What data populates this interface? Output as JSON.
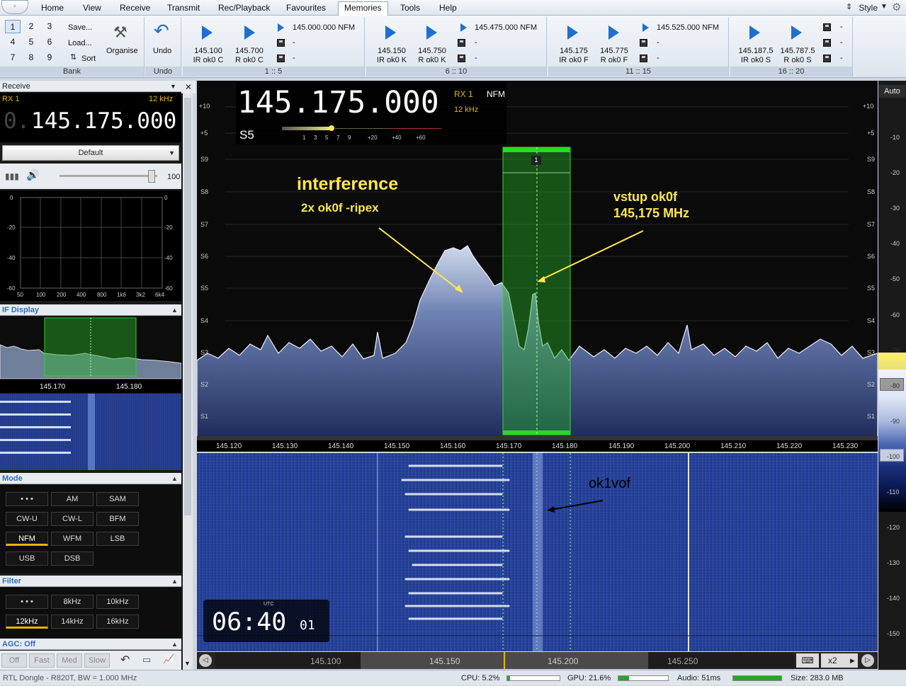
{
  "menu": {
    "items": [
      "Home",
      "View",
      "Receive",
      "Transmit",
      "Rec/Playback",
      "Favourites",
      "Memories",
      "Tools",
      "Help"
    ],
    "active": "Memories",
    "style": "Style"
  },
  "ribbon": {
    "bank": {
      "numbers": [
        "1",
        "2",
        "3",
        "4",
        "5",
        "6",
        "7",
        "8",
        "9"
      ],
      "save": "Save...",
      "load": "Load...",
      "sort": "Sort",
      "organise": "Organise",
      "label": "Bank"
    },
    "undo": {
      "button": "Undo",
      "label": "Undo"
    },
    "groups": [
      {
        "label": "1 :: 5",
        "m1": {
          "freq": "145.100",
          "name": "IR ok0 C"
        },
        "m2": {
          "freq": "145.700",
          "name": "R ok0 C"
        },
        "m3": {
          "text": "145.000.000 NFM"
        }
      },
      {
        "label": "6 :: 10",
        "m1": {
          "freq": "145.150",
          "name": "IR ok0 K"
        },
        "m2": {
          "freq": "145.750",
          "name": "R ok0 K"
        },
        "m3": {
          "text": "145.475.000 NFM"
        }
      },
      {
        "label": "11 :: 15",
        "m1": {
          "freq": "145.175",
          "name": "IR ok0 F"
        },
        "m2": {
          "freq": "145.775",
          "name": "R ok0 F"
        },
        "m3": {
          "text": "145.525.000 NFM"
        }
      },
      {
        "label": "16 :: 20",
        "m1": {
          "freq": "145.187.5",
          "name": "IR ok0 S"
        },
        "m2": {
          "freq": "145.787.5",
          "name": "R ok0 S"
        },
        "m3": {
          "text": ""
        }
      }
    ]
  },
  "left": {
    "receive_title": "Receive",
    "rx": "RX 1",
    "bw": "12 kHz",
    "freq_dim": "0.",
    "freq": "145.175.000",
    "preset": "Default",
    "volume": "100",
    "audio_xticks": [
      "50",
      "100",
      "200",
      "400",
      "800",
      "1k6",
      "3k2",
      "6k4"
    ],
    "audio_yticks": [
      "0",
      "-20",
      "-40",
      "-60"
    ],
    "if_display": "IF Display",
    "if_ticks": [
      "145.170",
      "145.180"
    ],
    "mode_title": "Mode",
    "modes": [
      "• • •",
      "AM",
      "SAM",
      "CW-U",
      "CW-L",
      "BFM",
      "NFM",
      "WFM",
      "LSB",
      "USB",
      "DSB"
    ],
    "mode_selected": "NFM",
    "filter_title": "Filter",
    "filters": [
      "• • •",
      "8kHz",
      "10kHz",
      "12kHz",
      "14kHz",
      "16kHz"
    ],
    "filter_selected": "12kHz",
    "agc_title": "AGC: Off",
    "agc": [
      "Off",
      "Fast",
      "Med",
      "Slow"
    ]
  },
  "spectrum": {
    "freq": "145.175.000",
    "rx": "RX 1",
    "mode": "NFM",
    "bw": "12 kHz",
    "smeter": "S5",
    "smeter_ticks": [
      "1",
      "3",
      "5",
      "7",
      "9",
      "+20",
      "+40",
      "+60"
    ],
    "left_ticks": [
      "+10",
      "+5",
      "S9",
      "S8",
      "S7",
      "S6",
      "S5",
      "S4",
      "S3",
      "S2",
      "S1"
    ],
    "xticks": [
      "145.120",
      "145.130",
      "145.140",
      "145.150",
      "145.160",
      "145.170",
      "145.180",
      "145.190",
      "145.200",
      "145.210",
      "145.220",
      "145.230"
    ],
    "channel_num": "1",
    "annot1_title": "interference",
    "annot1_sub": "2x ok0f -ripex",
    "annot2_l1": "vstup ok0f",
    "annot2_l2": "145,175 MHz"
  },
  "waterfall": {
    "annot": "ok1vof",
    "clock_hm": "06:40",
    "clock_s": "01",
    "utc": "UTC"
  },
  "right_scale": {
    "auto": "Auto",
    "ticks": [
      "-10",
      "-20",
      "-30",
      "-40",
      "-50",
      "-60",
      "-70",
      "-80",
      "-90",
      "-100",
      "-110",
      "-120",
      "-130",
      "-140",
      "-150"
    ]
  },
  "bottom": {
    "ticks": [
      "145.100",
      "145.150",
      "145.200",
      "145.250"
    ],
    "zoom": "x2"
  },
  "status": {
    "device": "RTL Dongle - R820T, BW = 1.000 MHz",
    "cpu": "CPU: 5.2%",
    "gpu": "GPU: 21.6%",
    "audio": "Audio: 51ms",
    "size": "Size: 283.0 MB",
    "cpu_level": 0.052,
    "gpu_level": 0.216,
    "audio_level": 1.0
  }
}
